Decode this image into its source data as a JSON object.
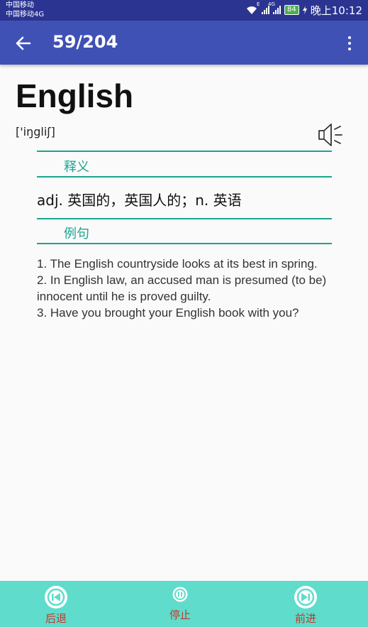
{
  "status_bar": {
    "carrier1": "中国移动",
    "carrier2": "中国移动4G",
    "sig1_badge": "E",
    "sig2_badge": "4G",
    "battery": "84",
    "time": "晚上10:12"
  },
  "app_bar": {
    "counter": "59/204"
  },
  "entry": {
    "word": "English",
    "phonetic": "['iŋgliʃ]",
    "definition_label": "释义",
    "definition": "adj. 英国的，英国人的；n. 英语",
    "examples_label": "例句",
    "examples": [
      "1. The English countryside looks at its best in spring.",
      "2. In English law, an accused man is presumed (to be) innocent until he is proved guilty.",
      "3. Have you brought your English book with you?"
    ]
  },
  "bottom_bar": {
    "back_label": "后退",
    "stop_label": "停止",
    "forward_label": "前进"
  },
  "colors": {
    "app_bar": "#3f51b5",
    "status_bar": "#2b3591",
    "accent": "#1aa58e",
    "bottom_bar": "#5fdccb",
    "bottom_label": "#c0392b"
  }
}
